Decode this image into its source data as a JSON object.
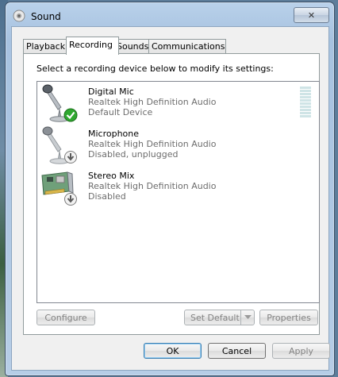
{
  "window": {
    "title": "Sound",
    "close_glyph": "✕"
  },
  "tabs": [
    {
      "label": "Playback",
      "active": false
    },
    {
      "label": "Recording",
      "active": true
    },
    {
      "label": "Sounds",
      "active": false
    },
    {
      "label": "Communications",
      "active": false
    }
  ],
  "panel": {
    "instruction": "Select a recording device below to modify its settings:",
    "devices": [
      {
        "name": "Digital Mic",
        "driver": "Realtek High Definition Audio",
        "status": "Default Device",
        "icon": "microphone-icon",
        "badge": "green-check-badge",
        "level_bars": 10
      },
      {
        "name": "Microphone",
        "driver": "Realtek High Definition Audio",
        "status": "Disabled, unplugged",
        "icon": "microphone-icon",
        "badge": "disabled-arrow-badge"
      },
      {
        "name": "Stereo Mix",
        "driver": "Realtek High Definition Audio",
        "status": "Disabled",
        "icon": "sound-card-icon",
        "badge": "disabled-arrow-badge"
      }
    ],
    "buttons": {
      "configure": "Configure",
      "set_default": "Set Default",
      "properties": "Properties"
    }
  },
  "footer": {
    "ok": "OK",
    "cancel": "Cancel",
    "apply": "Apply"
  },
  "colors": {
    "badge_green": "#2fa82f",
    "badge_gray": "#7c7c7c",
    "disabled_text": "#838383"
  }
}
